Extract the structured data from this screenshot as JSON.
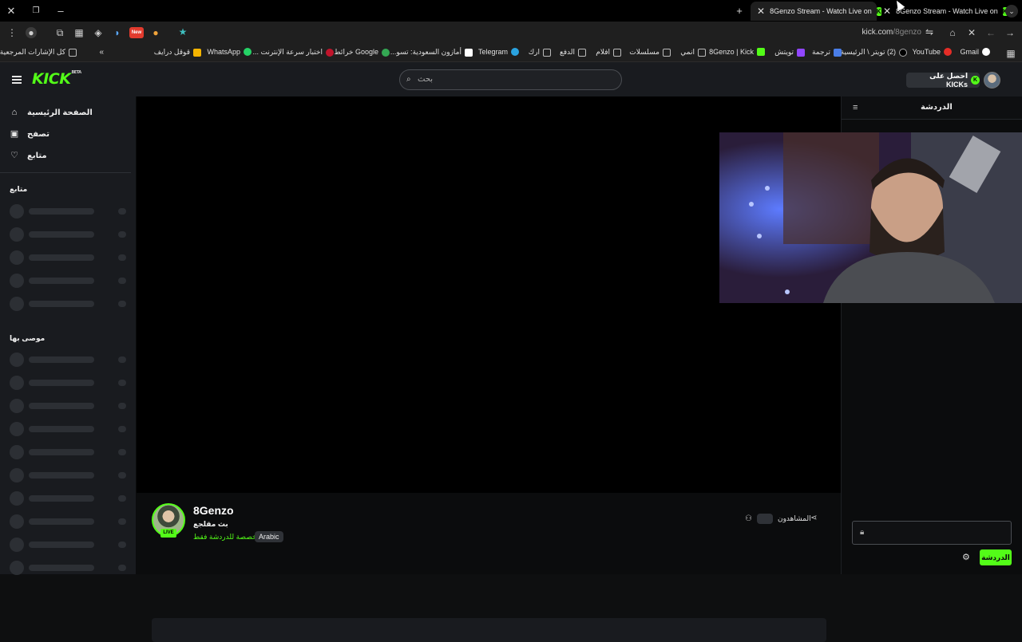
{
  "browser": {
    "tabs": [
      {
        "title": "8Genzo Stream - Watch Live on",
        "close": "✕",
        "active": true
      },
      {
        "title": "8Genzo Stream - Watch Live on",
        "close": "✕",
        "active": false
      }
    ],
    "new_tab": "+",
    "url_host": "kick.com",
    "url_path": "/8genzo",
    "bookmarks": [
      "Gmail",
      "YouTube",
      "(2) تويتر \\ الرئيسية",
      "ترجمة",
      "تويتش",
      "8Genzo | Kick",
      "انمي",
      "مسلسلات",
      "افلام",
      "الدفع",
      "ارك",
      "Telegram",
      "أمازون السعودية: تسو...",
      "Google خرائط",
      "اختبار سرعة الإنترنت ...",
      "WhatsApp",
      "قوقل درايف",
      "كل الإشارات المرجعية"
    ],
    "new_badge": "New"
  },
  "kick": {
    "logo": "KICK",
    "logo_beta": "BETA",
    "search_placeholder": "بحث",
    "get_kicks": "احصل على KICKs",
    "sidebar": {
      "nav": [
        {
          "label": "الصفحة الرئيسية",
          "icon": "home-icon"
        },
        {
          "label": "تصفح",
          "icon": "browse-icon"
        },
        {
          "label": "متابع",
          "icon": "heart-icon"
        }
      ],
      "following_heading": "متابع",
      "recommended_heading": "موصى بها"
    },
    "channel": {
      "name": "8Genzo",
      "title": "بث مقلجع",
      "chat_only": "مخصصة للدردشة فقط",
      "language": "Arabic",
      "live": "LIVE",
      "viewers_label": "المشاهدون"
    },
    "chat": {
      "title": "الدردشة",
      "send_label": "الدردشة"
    }
  },
  "colors": {
    "accent": "#53fc18",
    "bg": "#0b0c0d",
    "panel": "#191b1f"
  }
}
